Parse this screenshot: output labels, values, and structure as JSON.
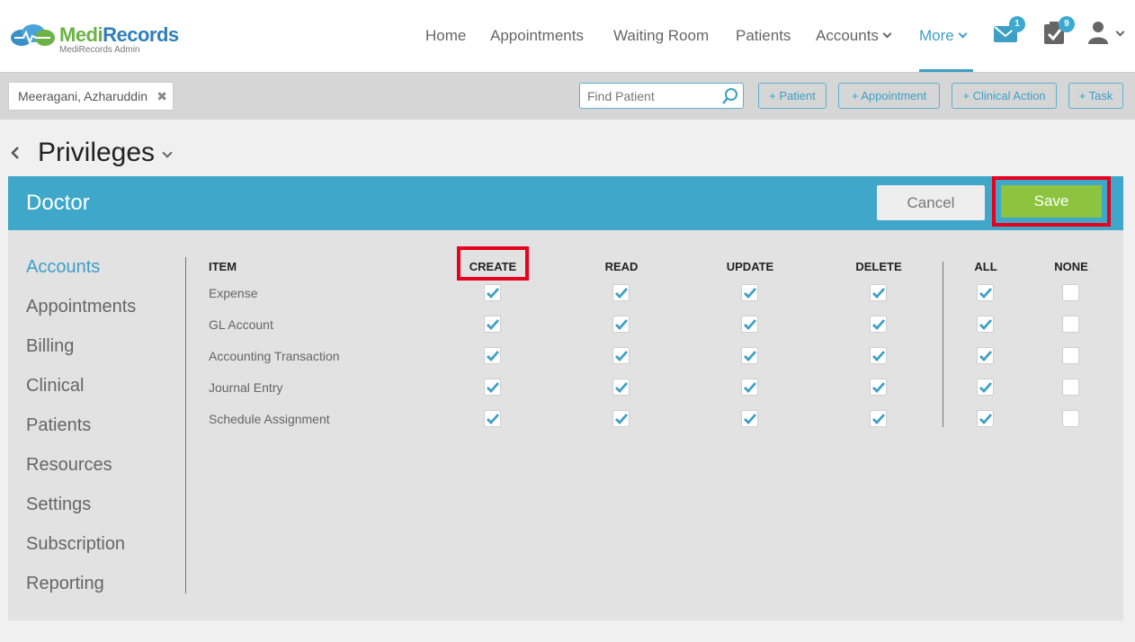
{
  "app": {
    "logo_primary": "Medi",
    "logo_secondary": "Records",
    "logo_subtitle": "MediRecords Admin",
    "accent": "#3d9fc6"
  },
  "nav": {
    "items": [
      {
        "label": "Home"
      },
      {
        "label": "Appointments"
      },
      {
        "label": "Waiting Room"
      },
      {
        "label": "Patients"
      },
      {
        "label": "Accounts",
        "dropdown": true
      },
      {
        "label": "More",
        "dropdown": true,
        "active": true
      }
    ],
    "messages_badge": "1",
    "tasks_badge": "9",
    "icons": [
      "envelope-icon",
      "clipboard-check-icon",
      "user-icon"
    ]
  },
  "toolbar": {
    "patient_name": "Meeragani, Azharuddin",
    "find_placeholder": "Find Patient",
    "buttons": [
      "+ Patient",
      "+ Appointment",
      "+ Clinical Action",
      "+ Task"
    ]
  },
  "page": {
    "title": "Privileges"
  },
  "panel": {
    "role": "Doctor",
    "cancel_label": "Cancel",
    "save_label": "Save",
    "save_color": "#8cc43f",
    "highlight_color": "#e8001c"
  },
  "sidebar": {
    "items": [
      {
        "label": "Accounts",
        "active": true
      },
      {
        "label": "Appointments"
      },
      {
        "label": "Billing"
      },
      {
        "label": "Clinical"
      },
      {
        "label": "Patients"
      },
      {
        "label": "Resources"
      },
      {
        "label": "Settings"
      },
      {
        "label": "Subscription"
      },
      {
        "label": "Reporting"
      }
    ]
  },
  "table": {
    "columns": [
      "ITEM",
      "CREATE",
      "READ",
      "UPDATE",
      "DELETE",
      "ALL",
      "NONE"
    ],
    "rows": [
      {
        "item": "Expense",
        "create": true,
        "read": true,
        "update": true,
        "delete": true,
        "all": true,
        "none": false
      },
      {
        "item": "GL Account",
        "create": true,
        "read": true,
        "update": true,
        "delete": true,
        "all": true,
        "none": false
      },
      {
        "item": "Accounting Transaction",
        "create": true,
        "read": true,
        "update": true,
        "delete": true,
        "all": true,
        "none": false
      },
      {
        "item": "Journal Entry",
        "create": true,
        "read": true,
        "update": true,
        "delete": true,
        "all": true,
        "none": false
      },
      {
        "item": "Schedule Assignment",
        "create": true,
        "read": true,
        "update": true,
        "delete": true,
        "all": true,
        "none": false
      }
    ]
  }
}
